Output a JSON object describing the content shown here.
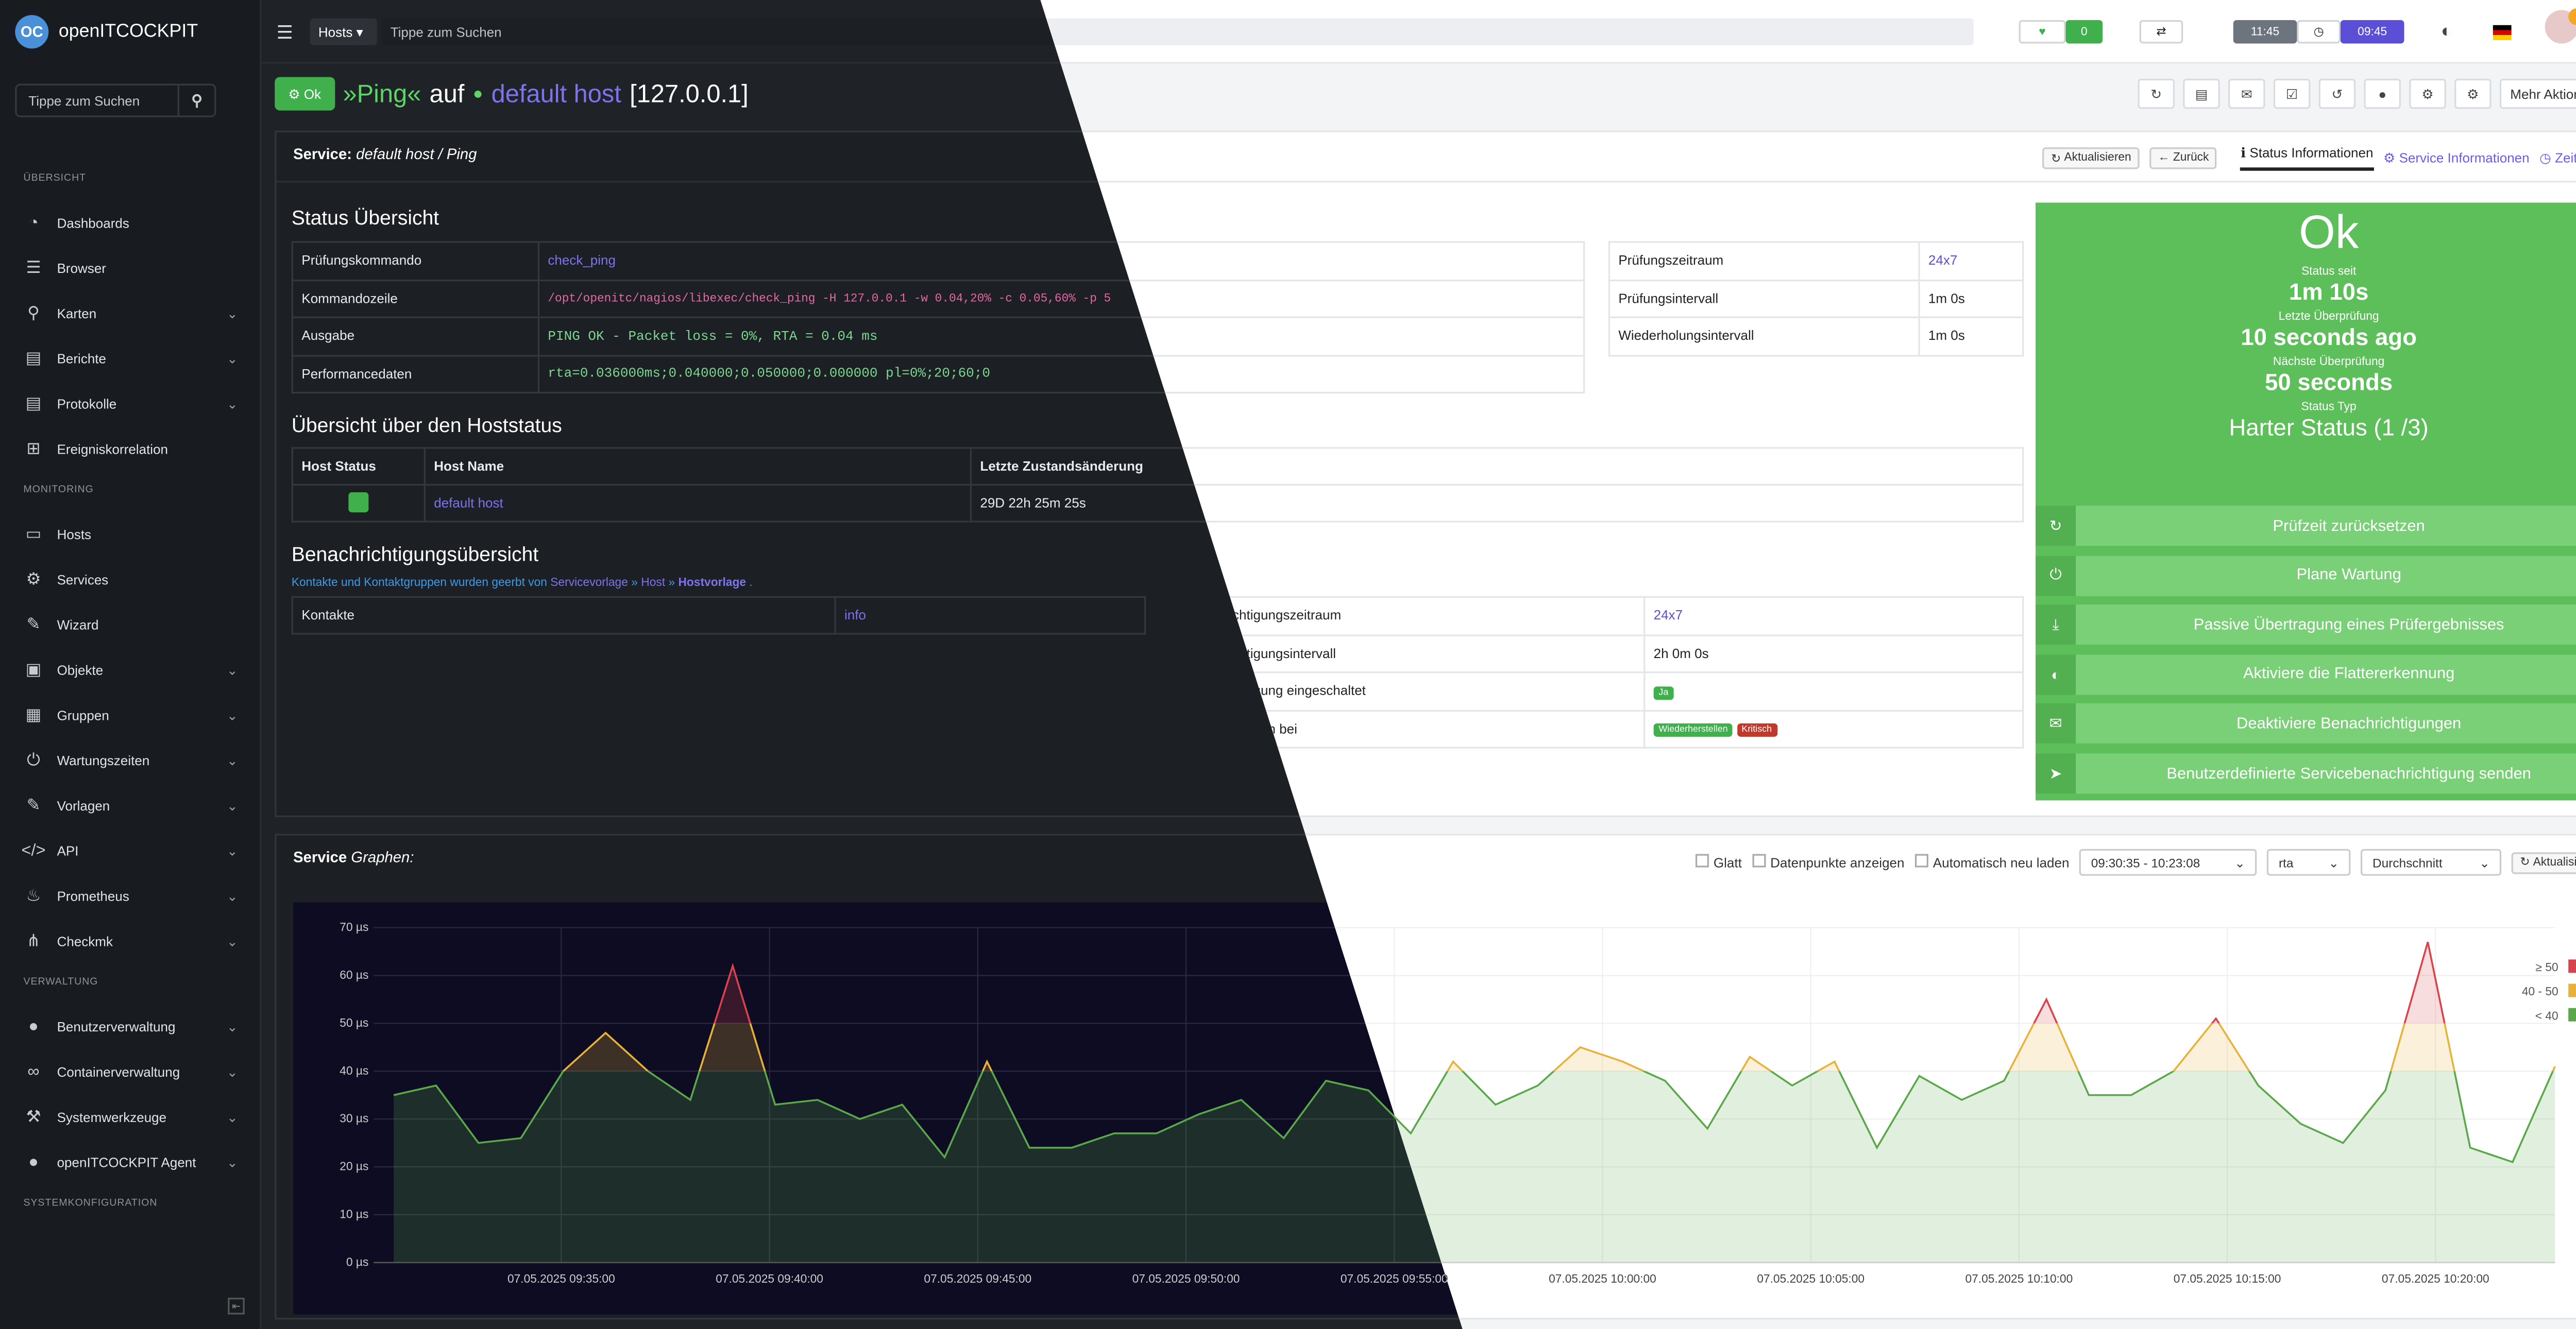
{
  "app": {
    "logo_text": "openITCOCKPIT",
    "logo_badge": "OC"
  },
  "sidebar": {
    "search_placeholder": "Tippe zum Suchen",
    "sections": [
      {
        "title": "ÜBERSICHT",
        "items": [
          {
            "label": "Dashboards",
            "icon": "dashboard-icon",
            "chev": false
          },
          {
            "label": "Browser",
            "icon": "list-icon",
            "chev": false
          },
          {
            "label": "Karten",
            "icon": "map-pin-icon",
            "chev": true
          },
          {
            "label": "Berichte",
            "icon": "report-icon",
            "chev": true
          },
          {
            "label": "Protokolle",
            "icon": "log-icon",
            "chev": true
          },
          {
            "label": "Ereigniskorrelation",
            "icon": "sitemap-icon",
            "chev": false
          }
        ]
      },
      {
        "title": "MONITORING",
        "items": [
          {
            "label": "Hosts",
            "icon": "desktop-icon",
            "chev": false
          },
          {
            "label": "Services",
            "icon": "gears-icon",
            "chev": false
          },
          {
            "label": "Wizard",
            "icon": "wand-icon",
            "chev": false
          },
          {
            "label": "Objekte",
            "icon": "cubes-icon",
            "chev": true
          },
          {
            "label": "Gruppen",
            "icon": "groups-icon",
            "chev": true
          },
          {
            "label": "Wartungszeiten",
            "icon": "power-icon",
            "chev": true
          },
          {
            "label": "Vorlagen",
            "icon": "edit-icon",
            "chev": true
          },
          {
            "label": "API",
            "icon": "code-icon",
            "chev": true
          },
          {
            "label": "Prometheus",
            "icon": "fire-icon",
            "chev": true
          },
          {
            "label": "Checkmk",
            "icon": "share-icon",
            "chev": true
          }
        ]
      },
      {
        "title": "VERWALTUNG",
        "items": [
          {
            "label": "Benutzerverwaltung",
            "icon": "users-icon",
            "chev": true
          },
          {
            "label": "Containerverwaltung",
            "icon": "link-icon",
            "chev": true
          },
          {
            "label": "Systemwerkzeuge",
            "icon": "tools-icon",
            "chev": true
          },
          {
            "label": "openITCOCKPIT Agent",
            "icon": "user-secret-icon",
            "chev": true
          }
        ]
      },
      {
        "title": "SYSTEMKONFIGURATION",
        "items": []
      }
    ]
  },
  "topbar": {
    "hosts_dropdown": "Hosts",
    "search_placeholder": "Tippe zum Suchen",
    "counter": "0",
    "time_left": "11:45",
    "time_right": "09:45"
  },
  "header": {
    "state_button": "Ok",
    "service_name": "»Ping«",
    "auf": "auf",
    "host_name": "default host",
    "ip": "[127.0.0.1]",
    "mehr_aktionen": "Mehr Aktionen"
  },
  "card": {
    "title": "Service:",
    "title_path": "default host / Ping",
    "btn_refresh": "Aktualisieren",
    "btn_back": "Zurück",
    "tab_status": "Status Informationen",
    "tab_service": "Service Informationen",
    "tab_timeline": "Zeitleiste"
  },
  "status_overview": {
    "title": "Status Übersicht",
    "rows": [
      {
        "label": "Prüfungskommando",
        "value": "check_ping"
      },
      {
        "label": "Kommandozeile",
        "value": "/opt/openitc/nagios/libexec/check_ping -H 127.0.0.1 -w 0.04,20% -c 0.05,60% -p 5"
      },
      {
        "label": "Ausgabe",
        "value": "PING OK - Packet loss = 0%, RTA = 0.04 ms"
      },
      {
        "label": "Performancedaten",
        "value": "rta=0.036000ms;0.040000;0.050000;0.000000 pl=0%;20;60;0"
      }
    ],
    "right_rows": [
      {
        "label": "Prüfungszeitraum",
        "value": "24x7"
      },
      {
        "label": "Prüfungsintervall",
        "value": "1m 0s"
      },
      {
        "label": "Wiederholungsintervall",
        "value": "1m 0s"
      }
    ]
  },
  "host_status": {
    "title": "Übersicht über den Hoststatus",
    "headers": [
      "Host Status",
      "Host Name",
      "Letzte Zustandsänderung"
    ],
    "row": {
      "host": "default host",
      "last_change": "29D 22h 25m 25s"
    }
  },
  "notifications": {
    "title": "Benachrichtigungsübersicht",
    "inherit_text": "Kontakte und Kontaktgruppen wurden geerbt von",
    "inherit_a": "Servicevorlage",
    "inherit_b": "Host",
    "inherit_c": "Hostvorlage",
    "inherit_end": ".",
    "contacts_label": "Kontakte",
    "contacts_value": "info",
    "right_rows": [
      {
        "label": "Benachrichtigungszeitraum",
        "value": "24x7"
      },
      {
        "label": "Benachrichtigungsintervall",
        "value": "2h 0m 0s"
      },
      {
        "label": "Benachrichtigung eingeschaltet",
        "value": "Ja"
      },
      {
        "label": "Benachrichtigen bei",
        "value": ""
      }
    ],
    "badge_recover": "Wiederherstellen",
    "badge_critical": "Kritisch"
  },
  "status_panel": {
    "state": "Ok",
    "since_label": "Status seit",
    "since_value": "1m 10s",
    "last_label": "Letzte Überprüfung",
    "last_value": "10 seconds ago",
    "next_label": "Nächste Überprüfung",
    "next_value": "50 seconds",
    "type_label": "Status Typ",
    "type_value": "Harter Status (1 /3)",
    "actions": [
      {
        "label": "Prüfzeit zurücksetzen",
        "icon": "refresh-icon"
      },
      {
        "label": "Plane Wartung",
        "icon": "power-icon"
      },
      {
        "label": "Passive Übertragung eines Prüfergebnisses",
        "icon": "download-icon"
      },
      {
        "label": "Aktiviere die Flattererkennung",
        "icon": "adjust-icon"
      },
      {
        "label": "Deaktiviere Benachrichtigungen",
        "icon": "envelope-icon"
      },
      {
        "label": "Benutzerdefinierte Servicebenachrichtigung senden",
        "icon": "send-icon"
      }
    ],
    "color": "#5cbf5a"
  },
  "graph": {
    "title": "Service",
    "title_sub": "Graphen:",
    "opt_smooth": "Glatt",
    "opt_points": "Datenpunkte anzeigen",
    "opt_reload": "Automatisch neu laden",
    "time_range": "09:30:35 - 10:23:08",
    "metric": "rta",
    "aggregation": "Durchschnitt",
    "btn_refresh": "Aktualisieren"
  },
  "chart_data": {
    "type": "area",
    "ylabel_ticks": [
      "0 µs",
      "10 µs",
      "20 µs",
      "30 µs",
      "40 µs",
      "50 µs",
      "60 µs",
      "70 µs"
    ],
    "ylim": [
      0,
      70
    ],
    "x_ticks": [
      "07.05.2025 09:35:00",
      "07.05.2025 09:40:00",
      "07.05.2025 09:45:00",
      "07.05.2025 09:50:00",
      "07.05.2025 09:55:00",
      "07.05.2025 10:00:00",
      "07.05.2025 10:05:00",
      "07.05.2025 10:10:00",
      "07.05.2025 10:15:00",
      "07.05.2025 10:20:00"
    ],
    "x_start_minutes": 0,
    "legend": [
      "≥ 50",
      "40 - 50",
      "< 40"
    ],
    "legend_colors": [
      "#d9434e",
      "#e8b23a",
      "#5aa84a"
    ],
    "values": [
      35,
      37,
      25,
      26,
      40,
      48,
      40,
      34,
      62,
      33,
      34,
      30,
      33,
      22,
      42,
      24,
      24,
      27,
      27,
      31,
      34,
      26,
      38,
      36,
      27,
      42,
      33,
      37,
      45,
      42,
      38,
      28,
      43,
      37,
      42,
      24,
      39,
      34,
      38,
      55,
      35,
      35,
      40,
      51,
      37,
      29,
      25,
      36,
      67,
      24,
      21,
      41
    ]
  }
}
